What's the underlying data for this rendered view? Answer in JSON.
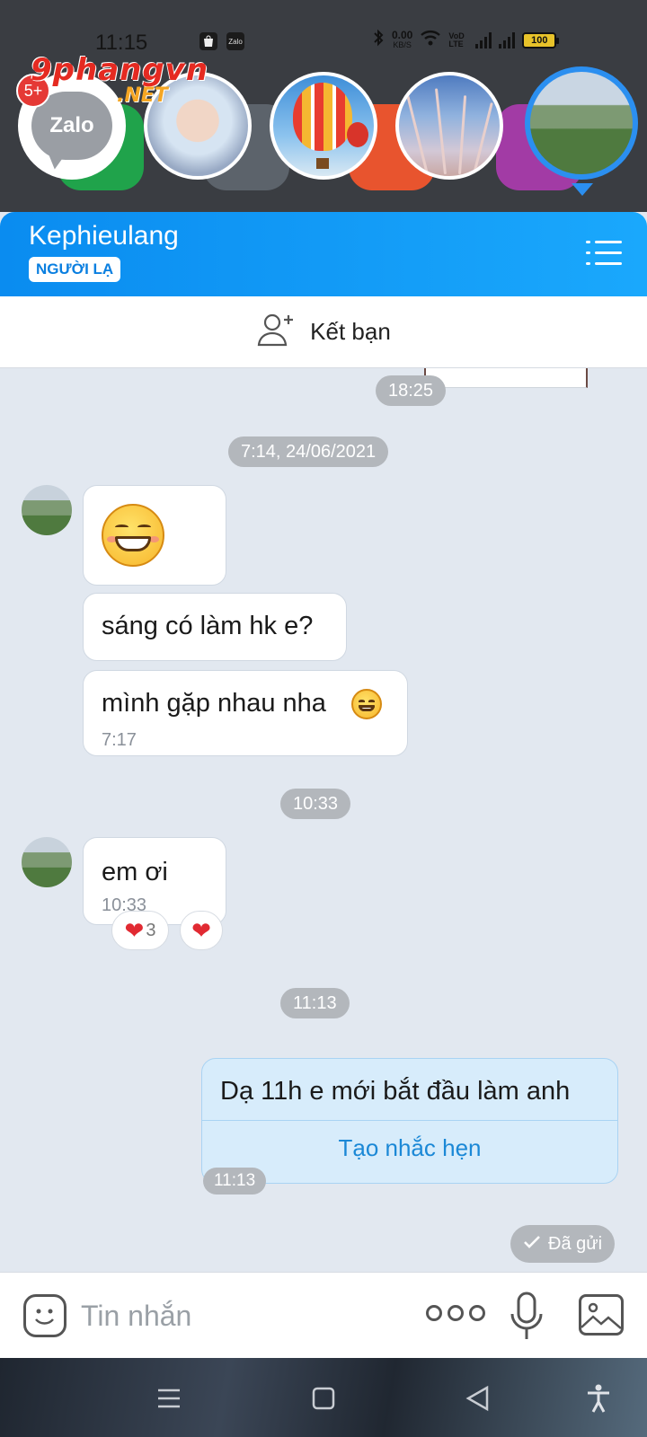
{
  "status_bar": {
    "time": "11:15",
    "net_speed_value": "0.00",
    "net_speed_unit": "KB/S",
    "volte_label": "VoD LTE",
    "battery": "100",
    "left_icons": [
      "shopping-bag-icon",
      "zalo-notification-icon"
    ],
    "right_icons": [
      "bluetooth-icon",
      "wifi-icon",
      "signal-icon",
      "signal-icon"
    ]
  },
  "watermark": {
    "main": "9phangvn",
    "net": ".NET"
  },
  "chat_heads": {
    "zalo_label": "Zalo",
    "unread_badge": "5+"
  },
  "header": {
    "contact_name": "Kephieulang",
    "stranger_badge": "NGƯỜI LẠ"
  },
  "friend_bar": {
    "label": "Kết bạn"
  },
  "messages": {
    "prev_time": "18:25",
    "date_separator": "7:14, 24/06/2021",
    "msg_question": "sáng có làm hk e?",
    "msg_meet": "mình gặp nhau nha",
    "msg_meet_time": "7:17",
    "sep_1033": "10:33",
    "msg_em_oi": "em ơi",
    "msg_em_oi_time": "10:33",
    "reaction_count": "3",
    "sep_1113": "11:13",
    "sent_text": "Dạ 11h e mới bắt đầu làm anh",
    "reminder_action": "Tạo nhắc hẹn",
    "sent_time": "11:13",
    "sent_status": "Đã gửi"
  },
  "input_bar": {
    "placeholder": "Tin nhắn"
  },
  "colors": {
    "header_blue": "#1aa8fc",
    "chat_bg": "#e2e8f0",
    "sent_bubble": "#d7ecfb",
    "reminder_link": "#1b88d6",
    "badge_red": "#e53935"
  }
}
